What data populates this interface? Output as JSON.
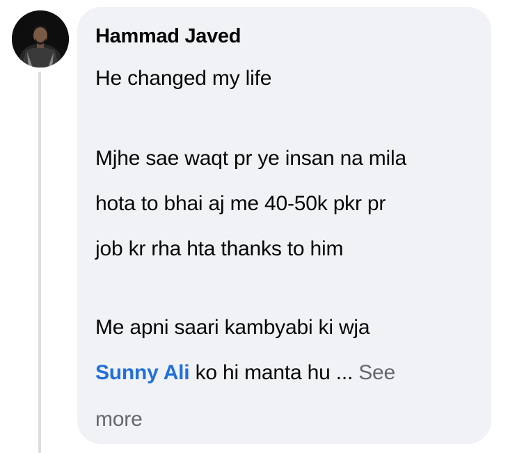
{
  "comment": {
    "author": "Hammad Javed",
    "lines": [
      "He changed my life",
      "Mjhe sae waqt pr ye insan na mila",
      "hota to bhai aj me 40-50k pkr pr",
      "job kr rha hta thanks to him",
      "Me apni saari kambyabi ki wja"
    ],
    "mention": "Sunny Ali",
    "after_mention": " ko hi manta hu ... ",
    "see_more_part1": "See",
    "see_more_part2": "more"
  },
  "colors": {
    "bubble": "#f0f2f5",
    "text": "#050505",
    "mention": "#216fdb",
    "see_more": "#65676b",
    "thread_line": "#dadde1"
  },
  "icons": {
    "avatar": "profile-photo"
  }
}
